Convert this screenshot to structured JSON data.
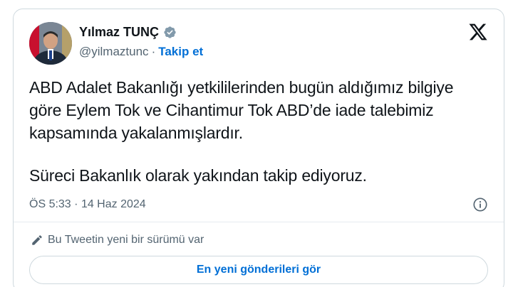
{
  "author": {
    "name": "Yılmaz TUNÇ",
    "handle": "@yilmaztunc",
    "separator": "·",
    "follow_label": "Takip et"
  },
  "icons": {
    "verified": "verified-badge-icon",
    "x_logo": "x-logo-icon",
    "info": "info-icon",
    "edit": "pencil-icon"
  },
  "tweet": {
    "paragraph_1": "ABD Adalet Bakanlığı yetkililerinden bugün aldığımız bilgiye göre Eylem Tok ve Cihantimur Tok ABD’de iade talebimiz kapsamında yakalanmışlardır.",
    "paragraph_2": "Süreci Bakanlık olarak yakından takip ediyoruz."
  },
  "meta": {
    "time": "ÖS 5:33",
    "separator": "·",
    "date": "14 Haz 2024"
  },
  "version_notice": "Bu Tweetin yeni bir sürümü var",
  "new_posts_button": "En yeni gönderileri gör",
  "colors": {
    "link_blue": "#006fd6",
    "verified_gray": "#829aab",
    "secondary_text": "#536471",
    "border": "#cfd9de"
  }
}
